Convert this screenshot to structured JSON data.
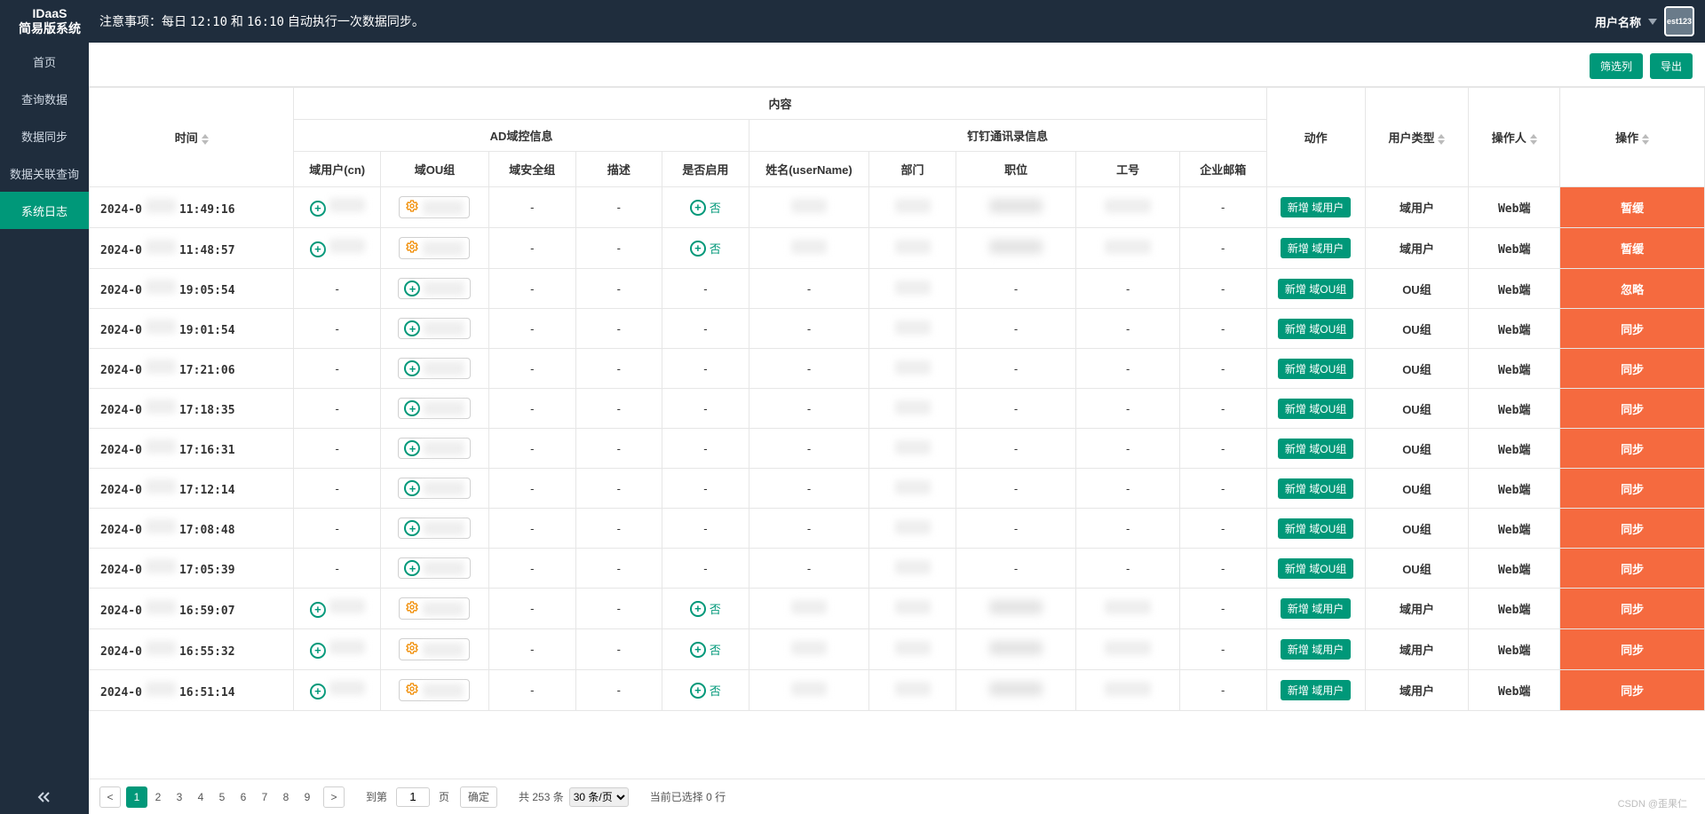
{
  "brand": {
    "line1": "IDaaS",
    "line2": "简易版系统"
  },
  "notice": {
    "prefix": "注意事项：",
    "body1": "每日 ",
    "t1": "12:10",
    "mid": " 和 ",
    "t2": "16:10",
    "body2": " 自动执行一次数据同步。"
  },
  "user": {
    "label": "用户名称",
    "avatar_alt": "est123"
  },
  "sidebar": {
    "items": [
      {
        "label": "首页"
      },
      {
        "label": "查询数据"
      },
      {
        "label": "数据同步"
      },
      {
        "label": "数据关联查询"
      },
      {
        "label": "系统日志"
      }
    ],
    "active_index": 4
  },
  "toolbar": {
    "filter_cols": "筛选列",
    "export": "导出"
  },
  "table": {
    "group_content": "内容",
    "group_ad": "AD域控信息",
    "group_dd": "钉钉通讯录信息",
    "cols": {
      "time": "时间",
      "cn": "域用户(cn)",
      "ou": "域OU组",
      "sec": "域安全组",
      "desc": "描述",
      "enabled": "是否启用",
      "username": "姓名(userName)",
      "dept": "部门",
      "title": "职位",
      "empno": "工号",
      "email": "企业邮箱",
      "action": "动作",
      "usertype": "用户类型",
      "operator": "操作人",
      "operation": "操作"
    },
    "no_value": "否",
    "dash": "-",
    "rows": [
      {
        "time": "2024-0     11:49:16",
        "type": "user",
        "enabled": "否",
        "action": "新增 域用户",
        "usertype": "域用户",
        "operator": "Web端",
        "operation": "暂缓"
      },
      {
        "time": "2024-0     11:48:57",
        "type": "user",
        "enabled": "否",
        "action": "新增 域用户",
        "usertype": "域用户",
        "operator": "Web端",
        "operation": "暂缓"
      },
      {
        "time": "2024-0     19:05:54",
        "type": "ou",
        "action": "新增 域OU组",
        "usertype": "OU组",
        "operator": "Web端",
        "operation": "忽略"
      },
      {
        "time": "2024-0     19:01:54",
        "type": "ou",
        "action": "新增 域OU组",
        "usertype": "OU组",
        "operator": "Web端",
        "operation": "同步"
      },
      {
        "time": "2024-0     17:21:06",
        "type": "ou",
        "action": "新增 域OU组",
        "usertype": "OU组",
        "operator": "Web端",
        "operation": "同步"
      },
      {
        "time": "2024-0     17:18:35",
        "type": "ou",
        "action": "新增 域OU组",
        "usertype": "OU组",
        "operator": "Web端",
        "operation": "同步"
      },
      {
        "time": "2024-0     17:16:31",
        "type": "ou",
        "action": "新增 域OU组",
        "usertype": "OU组",
        "operator": "Web端",
        "operation": "同步"
      },
      {
        "time": "2024-0     17:12:14",
        "type": "ou",
        "action": "新增 域OU组",
        "usertype": "OU组",
        "operator": "Web端",
        "operation": "同步"
      },
      {
        "time": "2024-0     17:08:48",
        "type": "ou",
        "action": "新增 域OU组",
        "usertype": "OU组",
        "operator": "Web端",
        "operation": "同步"
      },
      {
        "time": "2024-0     17:05:39",
        "type": "ou",
        "action": "新增 域OU组",
        "usertype": "OU组",
        "operator": "Web端",
        "operation": "同步"
      },
      {
        "time": "2024-0     16:59:07",
        "type": "user",
        "enabled": "否",
        "action": "新增 域用户",
        "usertype": "域用户",
        "operator": "Web端",
        "operation": "同步"
      },
      {
        "time": "2024-0     16:55:32",
        "type": "user",
        "enabled": "否",
        "action": "新增 域用户",
        "usertype": "域用户",
        "operator": "Web端",
        "operation": "同步"
      },
      {
        "time": "2024-0     16:51:14",
        "type": "user",
        "enabled": "否",
        "action": "新增 域用户",
        "usertype": "域用户",
        "operator": "Web端",
        "operation": "同步"
      }
    ]
  },
  "footer": {
    "pages": [
      "1",
      "2",
      "3",
      "4",
      "5",
      "6",
      "7",
      "8",
      "9"
    ],
    "goto_label_pre": "到第",
    "goto_label_post": "页",
    "confirm": "确定",
    "total": "共 253 条",
    "page_size_selected": "30 条/页",
    "selected_info": "当前已选择 0 行"
  },
  "watermark": "CSDN @歪果仁"
}
